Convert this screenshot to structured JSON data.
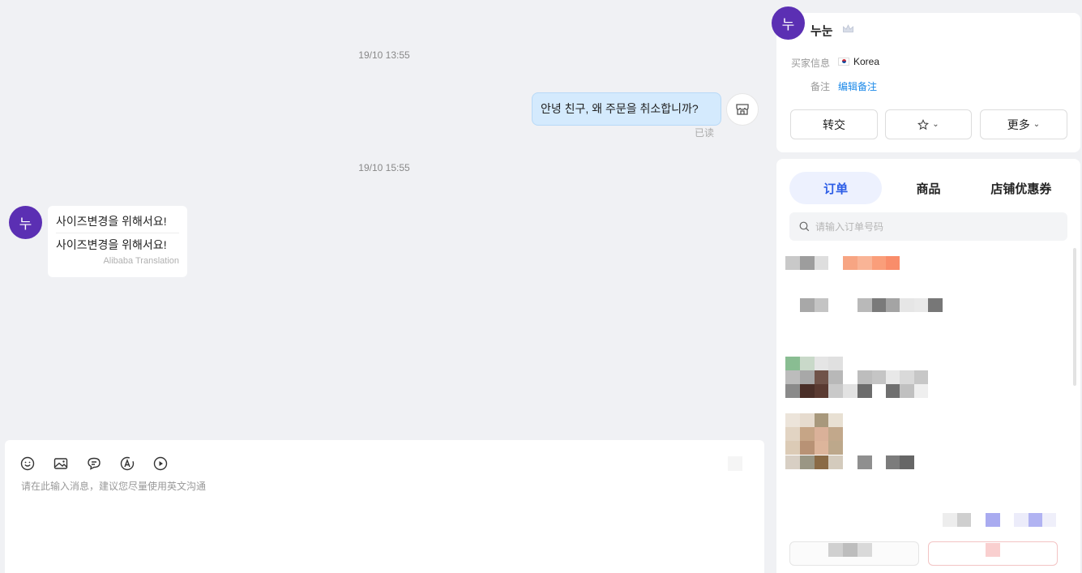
{
  "chat": {
    "timestamps": [
      "19/10 13:55",
      "19/10 15:55"
    ],
    "outgoing_message": "안녕 친구, 왜 주문을 취소합니까?",
    "read_status": "已读",
    "incoming": {
      "avatar_initial": "누",
      "original": "사이즈변경을 위해서요!",
      "translation": "사이즈변경을 위해서요!",
      "translation_source": "Alibaba Translation"
    }
  },
  "composer": {
    "placeholder": "请在此输入消息，建议您尽量使用英文沟通",
    "tools": [
      "emoji-icon",
      "image-icon",
      "quick-reply-icon",
      "translate-icon",
      "video-icon"
    ]
  },
  "buyer": {
    "avatar_initial": "누",
    "name": "누눈",
    "info_label": "买家信息",
    "country": "Korea",
    "note_label": "备注",
    "note_action": "编辑备注",
    "buttons": {
      "transfer": "转交",
      "more": "更多"
    }
  },
  "panel": {
    "tabs": [
      "订单",
      "商品",
      "店铺优惠券"
    ],
    "active_tab": 0,
    "search_placeholder": "请输入订单号码"
  },
  "colors": {
    "avatar": "#5b2fb3",
    "outgoing_bubble": "#d4eafd",
    "accent": "#2b5ce6",
    "link": "#1a88e8"
  }
}
